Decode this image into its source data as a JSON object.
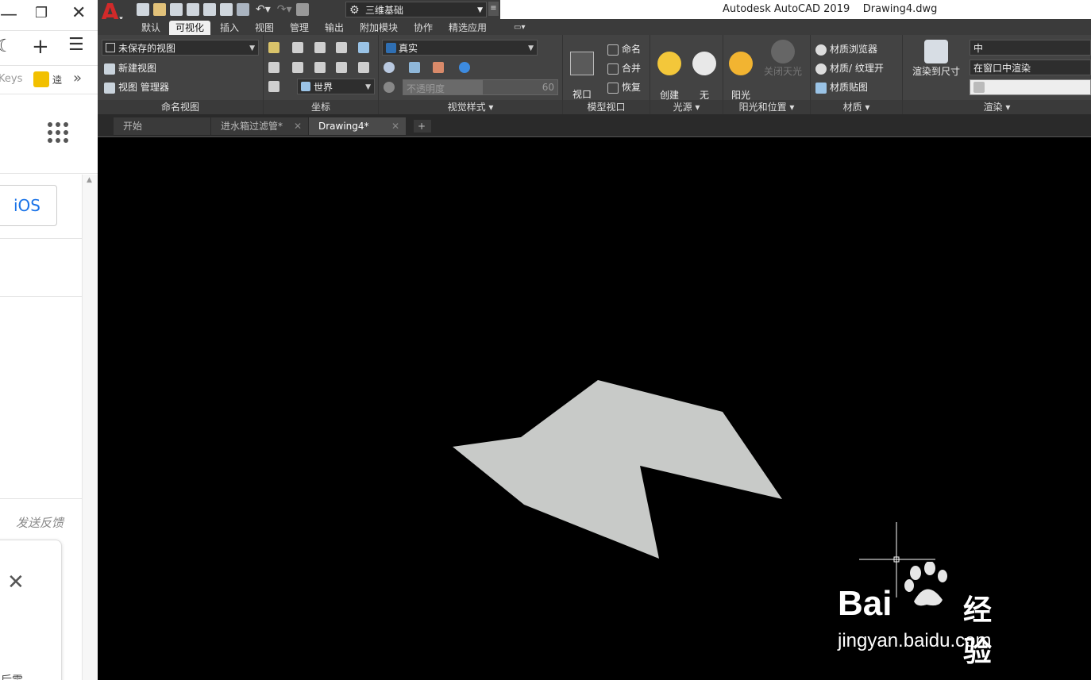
{
  "browser": {
    "keys_text": "Keys",
    "extension_text": "逵",
    "more": "»",
    "grid_icon": "apps-grid-icon",
    "ios_label": "iOS",
    "feedback": "发送反馈",
    "close": "✕",
    "bottom_text": "后需"
  },
  "app": {
    "title": "Autodesk AutoCAD 2019    Drawing4.dwg",
    "workspace": "三维基础",
    "logo": "A"
  },
  "ribbon_tabs": [
    "默认",
    "可视化",
    "插入",
    "视图",
    "管理",
    "输出",
    "附加模块",
    "协作",
    "精选应用"
  ],
  "ribbon": {
    "named_views": {
      "dropdown": "未保存的视图",
      "new_view": "新建视图",
      "view_manager": "视图 管理器",
      "title": "命名视图"
    },
    "coords": {
      "world": "世界",
      "title": "坐标"
    },
    "visual_styles": {
      "style": "真实",
      "opacity": "不透明度",
      "opacity_value": "60",
      "title": "视觉样式 ▾"
    },
    "model_viewports": {
      "viewport_config": "视口\n配置",
      "named": "命名",
      "join": "合并",
      "restore": "恢复",
      "title": "模型视口"
    },
    "lights": {
      "create": "创建\n光源",
      "no_shadow": "无\n阴影",
      "title": "光源 ▾"
    },
    "sun": {
      "sun_status": "阳光\n状态",
      "sky_off": "关闭天光",
      "title": "阳光和位置 ▾"
    },
    "materials": {
      "browser": "材质浏览器",
      "texture": "材质/ 纹理开",
      "mapping": "材质贴图",
      "title": "材质 ▾"
    },
    "render": {
      "render_size": "渲染到尺寸",
      "quality": "中",
      "render_in": "在窗口中渲染",
      "title": "渲染 ▾"
    }
  },
  "doc_tabs": [
    {
      "label": "开始",
      "close": ""
    },
    {
      "label": "进水箱过滤管*",
      "close": "✕"
    },
    {
      "label": "Drawing4*",
      "close": "✕"
    }
  ],
  "add_tab": "+",
  "watermark": {
    "brand": "Bai",
    "suffix": "经验",
    "url": "jingyan.baidu.com"
  },
  "colors": {
    "accent_red": "#d12a2a",
    "shape_fill": "#c8cac8",
    "ribbon_bg": "#434343"
  }
}
